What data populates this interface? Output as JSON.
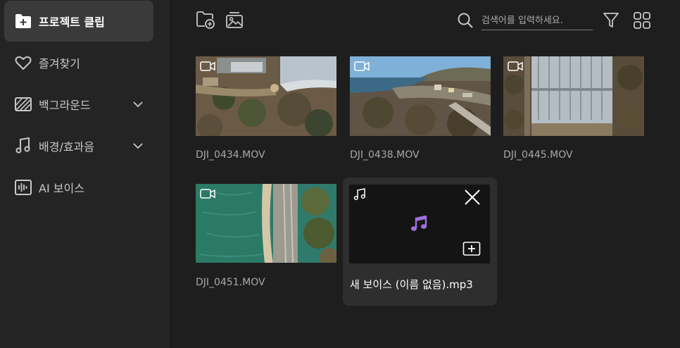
{
  "sidebar": {
    "items": [
      {
        "label": "프로젝트 클립",
        "icon": "folder-plus-icon",
        "active": true
      },
      {
        "label": "즐겨찾기",
        "icon": "heart-icon"
      },
      {
        "label": "백그라운드",
        "icon": "background-pattern-icon",
        "expandable": true
      },
      {
        "label": "배경/효과음",
        "icon": "music-note-icon",
        "expandable": true
      },
      {
        "label": "AI 보이스",
        "icon": "ai-voice-icon"
      }
    ]
  },
  "toolbar": {
    "import_folder_icon": "folder-add-icon",
    "import_media_icon": "image-gallery-icon",
    "search_placeholder": "검색어를 입력하세요.",
    "filter_icon": "filter-icon",
    "view_icon": "grid-view-icon"
  },
  "clips": [
    {
      "name": "DJI_0434.MOV",
      "type": "video"
    },
    {
      "name": "DJI_0438.MOV",
      "type": "video"
    },
    {
      "name": "DJI_0445.MOV",
      "type": "video"
    },
    {
      "name": "DJI_0451.MOV",
      "type": "video"
    },
    {
      "name": "새 보이스 (이름 없음).mp3",
      "type": "audio",
      "selected": true
    }
  ],
  "colors": {
    "accent_music": "#a06ee0",
    "active_item_bg": "#3a3a3a"
  }
}
